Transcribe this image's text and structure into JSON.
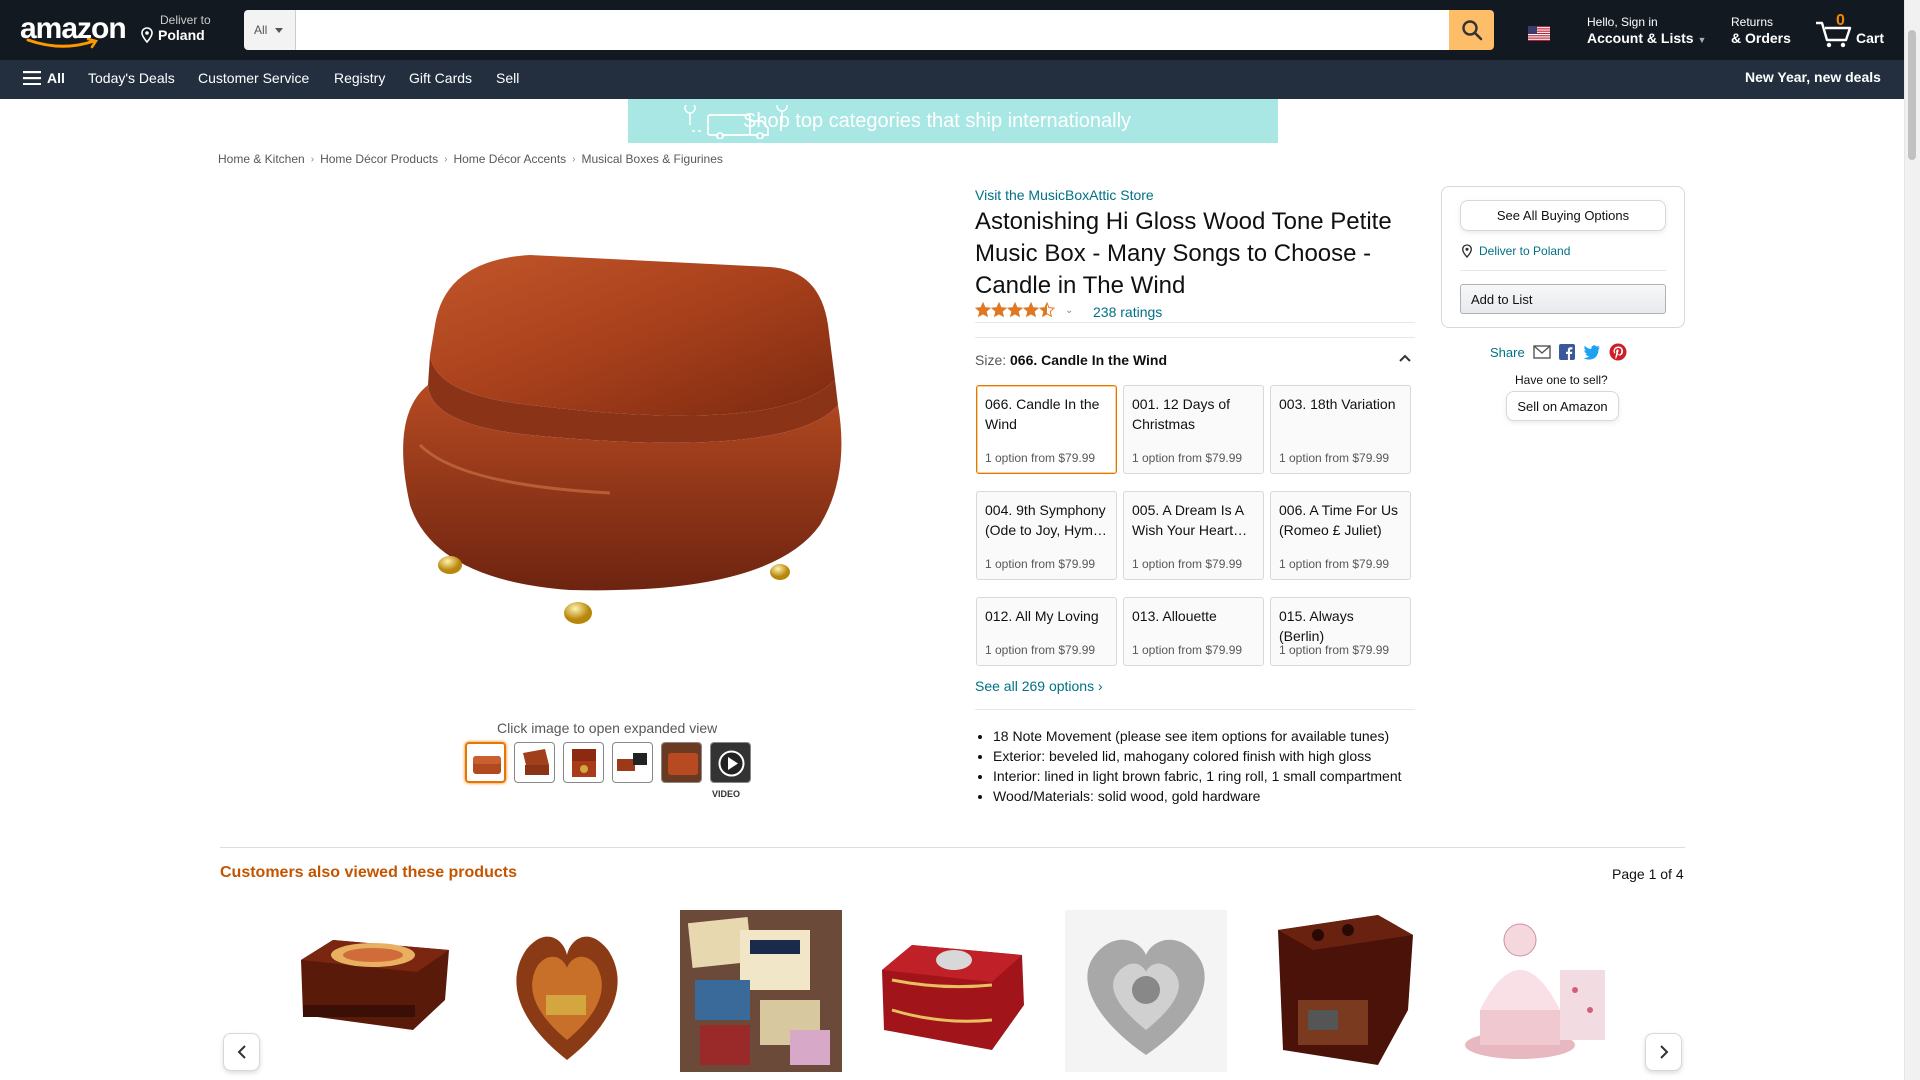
{
  "header": {
    "logo": "amazon",
    "deliver_line1": "Deliver to",
    "deliver_line2": "Poland",
    "search_category": "All",
    "search_placeholder": "",
    "account_line1": "Hello, Sign in",
    "account_line2": "Account & Lists",
    "returns_line1": "Returns",
    "returns_line2": "& Orders",
    "cart_count": "0",
    "cart_label": "Cart"
  },
  "subnav": {
    "all": "All",
    "items": [
      "Today's Deals",
      "Customer Service",
      "Registry",
      "Gift Cards",
      "Sell"
    ],
    "promo": "New Year, new deals"
  },
  "banner": {
    "text": "Shop top categories that ship internationally"
  },
  "breadcrumb": [
    "Home & Kitchen",
    "Home Décor Products",
    "Home Décor Accents",
    "Musical Boxes & Figurines"
  ],
  "product": {
    "store_link": "Visit the MusicBoxAttic Store",
    "title": "Astonishing Hi Gloss Wood Tone Petite Music Box - Many Songs to Choose - Candle in The Wind",
    "rating_stars": 4.5,
    "ratings_link": "238 ratings",
    "size_label": "Size:",
    "size_value": "066. Candle In the Wind",
    "click_image": "Click image to open expanded view",
    "video_label": "VIDEO",
    "options": [
      {
        "name": "066. Candle In the Wind",
        "price": "1 option from $79.99"
      },
      {
        "name": "001. 12 Days of Christmas",
        "price": "1 option from $79.99"
      },
      {
        "name": "003. 18th Variation",
        "price": "1 option from $79.99"
      },
      {
        "name": "004. 9th Symphony (Ode to Joy, Hym…",
        "price": "1 option from $79.99"
      },
      {
        "name": "005. A Dream Is A Wish Your Heart…",
        "price": "1 option from $79.99"
      },
      {
        "name": "006. A Time For Us (Romeo £ Juliet)",
        "price": "1 option from $79.99"
      },
      {
        "name": "012. All My Loving",
        "price": "1 option from $79.99"
      },
      {
        "name": "013. Allouette",
        "price": "1 option from $79.99"
      },
      {
        "name": "015. Always (Berlin)",
        "price": "1 option from $79.99"
      }
    ],
    "see_all": "See all 269 options",
    "bullets": [
      "18 Note Movement (please see item options for available tunes)",
      "Exterior: beveled lid, mahogany colored finish with high gloss",
      "Interior: lined in light brown fabric, 1 ring roll, 1 small compartment",
      "Wood/Materials: solid wood, gold hardware"
    ]
  },
  "buybox": {
    "see_all_buying": "See All Buying Options",
    "deliver": "Deliver to Poland",
    "add_to_list": "Add to List",
    "share": "Share",
    "have_one": "Have one to sell?",
    "sell_on": "Sell on Amazon"
  },
  "carousel": {
    "heading": "Customers also viewed these products",
    "page": "Page 1 of 4"
  },
  "colors": {
    "nav_dark": "#131921",
    "nav_sub": "#232f3e",
    "search_button": "#febd69",
    "link": "#007185",
    "accent_orange": "#c45500",
    "selected_border": "#e77600"
  }
}
